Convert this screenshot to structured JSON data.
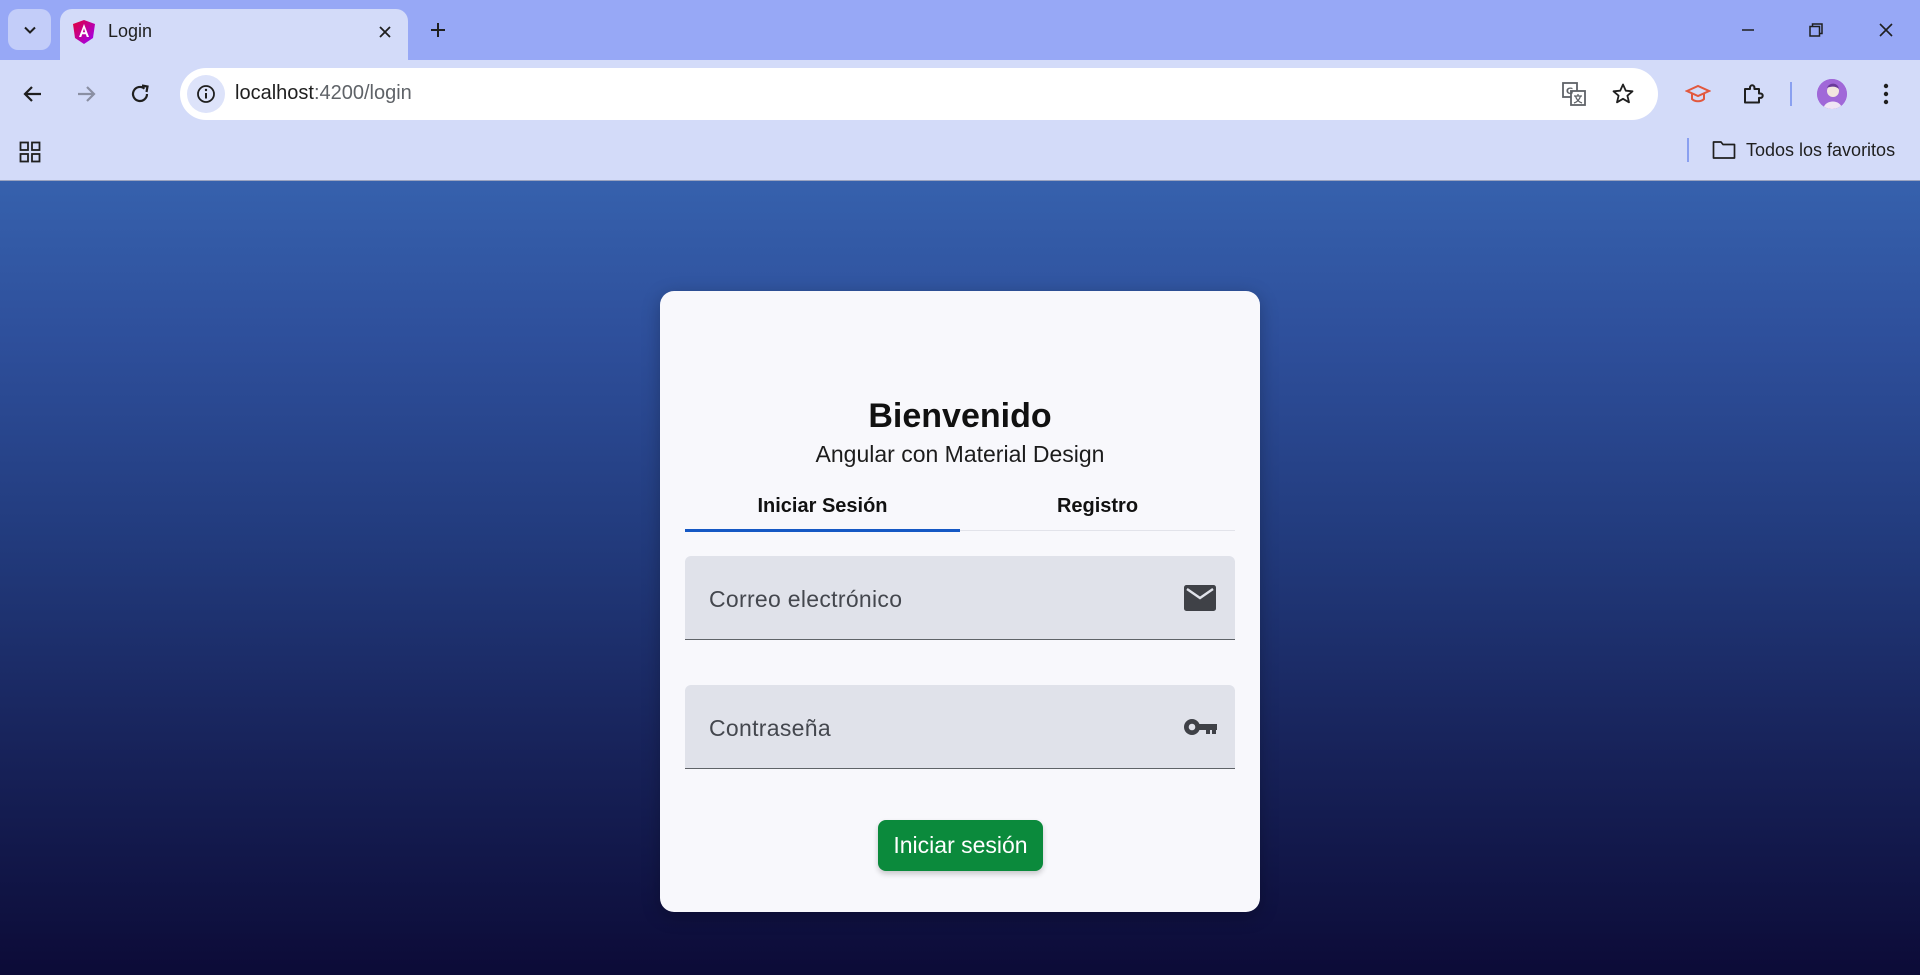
{
  "browser": {
    "tab": {
      "title": "Login"
    },
    "address": {
      "host": "localhost",
      "path": ":4200/login"
    },
    "bookmarks": {
      "folder_label": "Todos los favoritos"
    }
  },
  "colors": {
    "card_bg": "#f8f8fc",
    "tab_indicator": "#1558c4",
    "submit_button": "#0b8a3c",
    "gradient_top": "#3661ad",
    "gradient_bottom": "#0c0b37"
  },
  "login": {
    "title": "Bienvenido",
    "subtitle": "Angular con Material Design",
    "tabs": [
      {
        "label": "Iniciar Sesión",
        "active": true
      },
      {
        "label": "Registro",
        "active": false
      }
    ],
    "email": {
      "label": "Correo electrónico",
      "icon": "mail-icon"
    },
    "password": {
      "label": "Contraseña",
      "icon": "key-icon"
    },
    "submit_label": "Iniciar sesión"
  }
}
